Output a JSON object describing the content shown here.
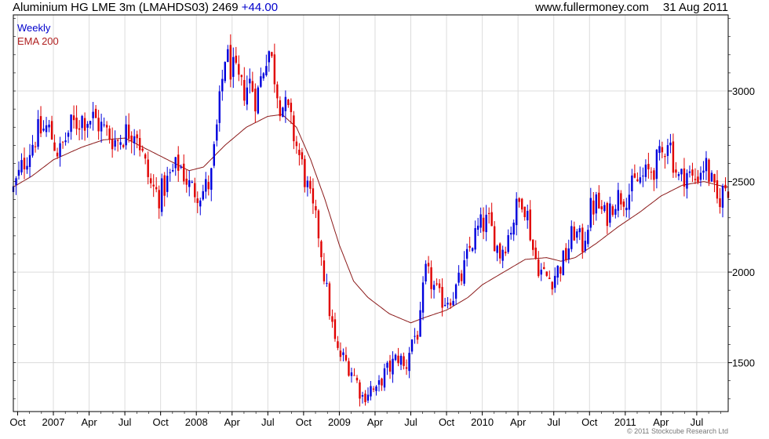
{
  "header": {
    "instrument": "Aluminium HG LME 3m (LMAHDS03)",
    "last": "2469",
    "change": "+44.00",
    "site": "www.fullermoney.com",
    "date": "31 Aug 2011"
  },
  "copyright": "© 2011 Stockcube Research Ltd",
  "colors": {
    "up": "#0000dd",
    "down": "#e00000",
    "ema": "#8b1a1a",
    "grid": "#dcdcdc"
  },
  "chart_data": {
    "type": "candlestick",
    "timeframe": "Weekly",
    "legend": [
      "Weekly",
      "EMA 200"
    ],
    "legend_placement": "top-left",
    "grid": true,
    "y_axis_side": "right",
    "ylim": [
      1230,
      3420
    ],
    "yticks": [
      1500,
      2000,
      2500,
      3000
    ],
    "x_range": [
      2006.72,
      2011.72
    ],
    "xticks": [
      {
        "t": 2006.75,
        "label": "Oct"
      },
      {
        "t": 2007.0,
        "label": "2007"
      },
      {
        "t": 2007.25,
        "label": "Apr"
      },
      {
        "t": 2007.5,
        "label": "Jul"
      },
      {
        "t": 2007.75,
        "label": "Oct"
      },
      {
        "t": 2008.0,
        "label": "2008"
      },
      {
        "t": 2008.25,
        "label": "Apr"
      },
      {
        "t": 2008.5,
        "label": "Jul"
      },
      {
        "t": 2008.75,
        "label": "Oct"
      },
      {
        "t": 2009.0,
        "label": "2009"
      },
      {
        "t": 2009.25,
        "label": "Apr"
      },
      {
        "t": 2009.5,
        "label": "Jul"
      },
      {
        "t": 2009.75,
        "label": "Oct"
      },
      {
        "t": 2010.0,
        "label": "2010"
      },
      {
        "t": 2010.25,
        "label": "Apr"
      },
      {
        "t": 2010.5,
        "label": "Jul"
      },
      {
        "t": 2010.75,
        "label": "Oct"
      },
      {
        "t": 2011.0,
        "label": "2011"
      },
      {
        "t": 2011.25,
        "label": "Apr"
      },
      {
        "t": 2011.5,
        "label": "Jul"
      }
    ],
    "price_path": [
      [
        2006.72,
        2450
      ],
      [
        2006.8,
        2620
      ],
      [
        2006.88,
        2760
      ],
      [
        2006.96,
        2800
      ],
      [
        2007.04,
        2650
      ],
      [
        2007.12,
        2800
      ],
      [
        2007.2,
        2850
      ],
      [
        2007.28,
        2850
      ],
      [
        2007.36,
        2780
      ],
      [
        2007.44,
        2720
      ],
      [
        2007.52,
        2780
      ],
      [
        2007.58,
        2800
      ],
      [
        2007.62,
        2650
      ],
      [
        2007.68,
        2480
      ],
      [
        2007.74,
        2420
      ],
      [
        2007.82,
        2530
      ],
      [
        2007.88,
        2600
      ],
      [
        2007.96,
        2460
      ],
      [
        2008.04,
        2440
      ],
      [
        2008.1,
        2500
      ],
      [
        2008.16,
        2900
      ],
      [
        2008.2,
        3200
      ],
      [
        2008.26,
        3100
      ],
      [
        2008.32,
        3000
      ],
      [
        2008.38,
        3050
      ],
      [
        2008.42,
        2950
      ],
      [
        2008.46,
        3100
      ],
      [
        2008.5,
        3250
      ],
      [
        2008.54,
        3120
      ],
      [
        2008.58,
        2950
      ],
      [
        2008.64,
        2880
      ],
      [
        2008.7,
        2700
      ],
      [
        2008.76,
        2520
      ],
      [
        2008.8,
        2380
      ],
      [
        2008.86,
        2200
      ],
      [
        2008.9,
        1950
      ],
      [
        2008.94,
        1750
      ],
      [
        2008.98,
        1560
      ],
      [
        2009.02,
        1530
      ],
      [
        2009.08,
        1470
      ],
      [
        2009.12,
        1400
      ],
      [
        2009.16,
        1310
      ],
      [
        2009.22,
        1360
      ],
      [
        2009.26,
        1330
      ],
      [
        2009.3,
        1420
      ],
      [
        2009.36,
        1480
      ],
      [
        2009.42,
        1540
      ],
      [
        2009.46,
        1450
      ],
      [
        2009.5,
        1620
      ],
      [
        2009.56,
        1680
      ],
      [
        2009.6,
        2000
      ],
      [
        2009.64,
        1950
      ],
      [
        2009.7,
        1850
      ],
      [
        2009.74,
        1850
      ],
      [
        2009.8,
        1880
      ],
      [
        2009.86,
        1980
      ],
      [
        2009.92,
        2150
      ],
      [
        2009.98,
        2250
      ],
      [
        2010.04,
        2280
      ],
      [
        2010.08,
        2200
      ],
      [
        2010.12,
        2100
      ],
      [
        2010.18,
        2200
      ],
      [
        2010.24,
        2350
      ],
      [
        2010.28,
        2420
      ],
      [
        2010.32,
        2300
      ],
      [
        2010.36,
        2100
      ],
      [
        2010.42,
        1990
      ],
      [
        2010.48,
        1960
      ],
      [
        2010.52,
        2000
      ],
      [
        2010.58,
        2080
      ],
      [
        2010.64,
        2230
      ],
      [
        2010.7,
        2150
      ],
      [
        2010.76,
        2350
      ],
      [
        2010.8,
        2380
      ],
      [
        2010.86,
        2300
      ],
      [
        2010.92,
        2400
      ],
      [
        2010.96,
        2420
      ],
      [
        2011.02,
        2430
      ],
      [
        2011.08,
        2500
      ],
      [
        2011.14,
        2530
      ],
      [
        2011.2,
        2580
      ],
      [
        2011.26,
        2650
      ],
      [
        2011.3,
        2760
      ],
      [
        2011.34,
        2600
      ],
      [
        2011.38,
        2500
      ],
      [
        2011.42,
        2560
      ],
      [
        2011.48,
        2500
      ],
      [
        2011.52,
        2560
      ],
      [
        2011.56,
        2600
      ],
      [
        2011.6,
        2500
      ],
      [
        2011.64,
        2380
      ],
      [
        2011.67,
        2430
      ],
      [
        2011.7,
        2469
      ]
    ],
    "ema_200": [
      [
        2006.72,
        2470
      ],
      [
        2006.85,
        2530
      ],
      [
        2007.0,
        2620
      ],
      [
        2007.2,
        2690
      ],
      [
        2007.35,
        2730
      ],
      [
        2007.5,
        2740
      ],
      [
        2007.65,
        2680
      ],
      [
        2007.8,
        2620
      ],
      [
        2007.95,
        2560
      ],
      [
        2008.05,
        2580
      ],
      [
        2008.2,
        2700
      ],
      [
        2008.35,
        2800
      ],
      [
        2008.5,
        2860
      ],
      [
        2008.6,
        2870
      ],
      [
        2008.7,
        2800
      ],
      [
        2008.8,
        2620
      ],
      [
        2008.9,
        2400
      ],
      [
        2009.0,
        2150
      ],
      [
        2009.1,
        1950
      ],
      [
        2009.2,
        1860
      ],
      [
        2009.35,
        1770
      ],
      [
        2009.5,
        1720
      ],
      [
        2009.6,
        1750
      ],
      [
        2009.75,
        1790
      ],
      [
        2009.9,
        1860
      ],
      [
        2010.0,
        1930
      ],
      [
        2010.15,
        2000
      ],
      [
        2010.3,
        2070
      ],
      [
        2010.45,
        2080
      ],
      [
        2010.55,
        2060
      ],
      [
        2010.65,
        2080
      ],
      [
        2010.8,
        2160
      ],
      [
        2010.95,
        2250
      ],
      [
        2011.1,
        2330
      ],
      [
        2011.25,
        2420
      ],
      [
        2011.4,
        2480
      ],
      [
        2011.55,
        2500
      ],
      [
        2011.7,
        2470
      ]
    ]
  }
}
